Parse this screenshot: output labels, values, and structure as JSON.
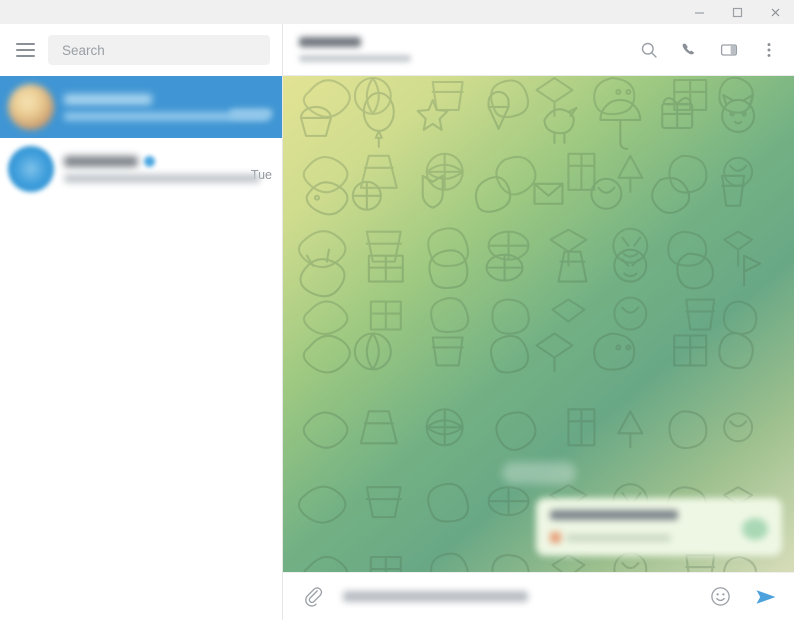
{
  "window": {
    "controls": [
      {
        "name": "minimize",
        "glyph": "minimize-icon",
        "label": "Minimize"
      },
      {
        "name": "maximize",
        "glyph": "maximize-icon",
        "label": "Maximize"
      },
      {
        "name": "close",
        "glyph": "close-icon",
        "label": "Close"
      }
    ]
  },
  "sidebar": {
    "menu_icon": "hamburger-menu-icon",
    "search": {
      "placeholder": "Search",
      "value": ""
    },
    "chats": [
      {
        "name": "",
        "name_hidden": true,
        "preview": "",
        "time": "",
        "time_hidden": true,
        "selected": true,
        "avatar_type": "photo",
        "verified": false
      },
      {
        "name": "",
        "name_hidden": true,
        "preview": "",
        "time": "Tue",
        "time_hidden": false,
        "selected": false,
        "avatar_type": "telegram-logo",
        "verified": true
      }
    ]
  },
  "chat": {
    "title": "",
    "title_hidden": true,
    "subtitle": "",
    "subtitle_hidden": true,
    "actions": [
      {
        "name": "search-chat",
        "icon": "search-icon",
        "label": "Search"
      },
      {
        "name": "call",
        "icon": "phone-icon",
        "label": "Call"
      },
      {
        "name": "toggle-info-panel",
        "icon": "sidebar-panel-icon",
        "label": "Info"
      },
      {
        "name": "more-menu",
        "icon": "more-vertical-icon",
        "label": "More"
      }
    ],
    "date_separator": "",
    "date_separator_hidden": true,
    "messages": [
      {
        "direction": "outgoing",
        "text": "",
        "text_hidden": true,
        "time": "",
        "has_attachment_badge": true
      }
    ]
  },
  "composer": {
    "attach_icon": "paperclip-icon",
    "placeholder": "",
    "placeholder_hidden": true,
    "value": "",
    "emoji_icon": "emoji-smiley-icon",
    "send_icon": "send-arrow-icon"
  },
  "colors": {
    "titlebar": "#f0f0f0",
    "accent": "#4096d4",
    "send_blue": "#4da2dd",
    "bubble_out": "#eef7e4",
    "wallpaper_top_left": "#e3e394",
    "wallpaper_top_right": "#7aad75",
    "wallpaper_bottom_left": "#6aa785",
    "wallpaper_bottom_right": "#d5dcbb",
    "search_field": "#f1f1f1"
  }
}
